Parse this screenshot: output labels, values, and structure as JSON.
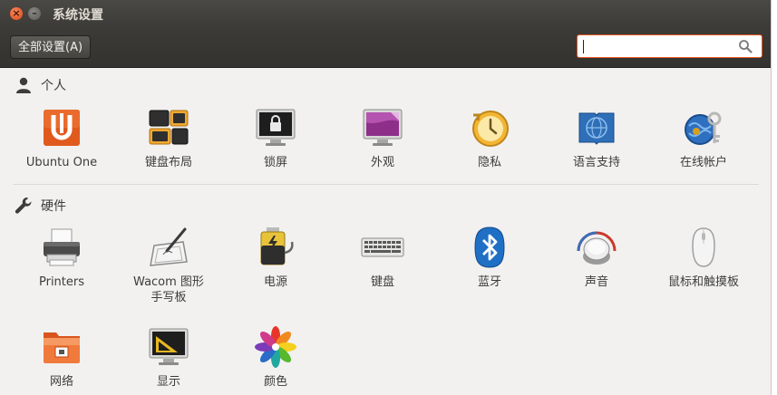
{
  "window": {
    "title": "系统设置",
    "close_glyph": "×",
    "minimize_glyph": "–"
  },
  "toolbar": {
    "all_settings_label": "全部设置(A)",
    "search_value": "",
    "search_icon": "search-icon"
  },
  "sections": {
    "personal": {
      "title": "个人",
      "icon": "person-icon",
      "items": [
        {
          "label": "Ubuntu One",
          "icon": "ubuntu-one-icon"
        },
        {
          "label": "键盘布局",
          "icon": "keyboard-layout-icon"
        },
        {
          "label": "锁屏",
          "icon": "lock-screen-icon"
        },
        {
          "label": "外观",
          "icon": "appearance-icon"
        },
        {
          "label": "隐私",
          "icon": "privacy-icon"
        },
        {
          "label": "语言支持",
          "icon": "language-support-icon"
        },
        {
          "label": "在线帐户",
          "icon": "online-accounts-icon"
        }
      ]
    },
    "hardware": {
      "title": "硬件",
      "icon": "wrench-icon",
      "items": [
        {
          "label": "Printers",
          "icon": "printer-icon"
        },
        {
          "label": "Wacom 图形\n手写板",
          "icon": "wacom-tablet-icon"
        },
        {
          "label": "电源",
          "icon": "power-icon"
        },
        {
          "label": "键盘",
          "icon": "keyboard-icon"
        },
        {
          "label": "蓝牙",
          "icon": "bluetooth-icon"
        },
        {
          "label": "声音",
          "icon": "sound-icon"
        },
        {
          "label": "鼠标和触摸板",
          "icon": "mouse-touchpad-icon"
        },
        {
          "label": "网络",
          "icon": "network-icon"
        },
        {
          "label": "显示",
          "icon": "display-icon"
        },
        {
          "label": "颜色",
          "icon": "color-icon"
        }
      ]
    }
  },
  "colors": {
    "accent": "#e95420",
    "titlebar": "#3c3b37",
    "background": "#f2f1f0"
  }
}
